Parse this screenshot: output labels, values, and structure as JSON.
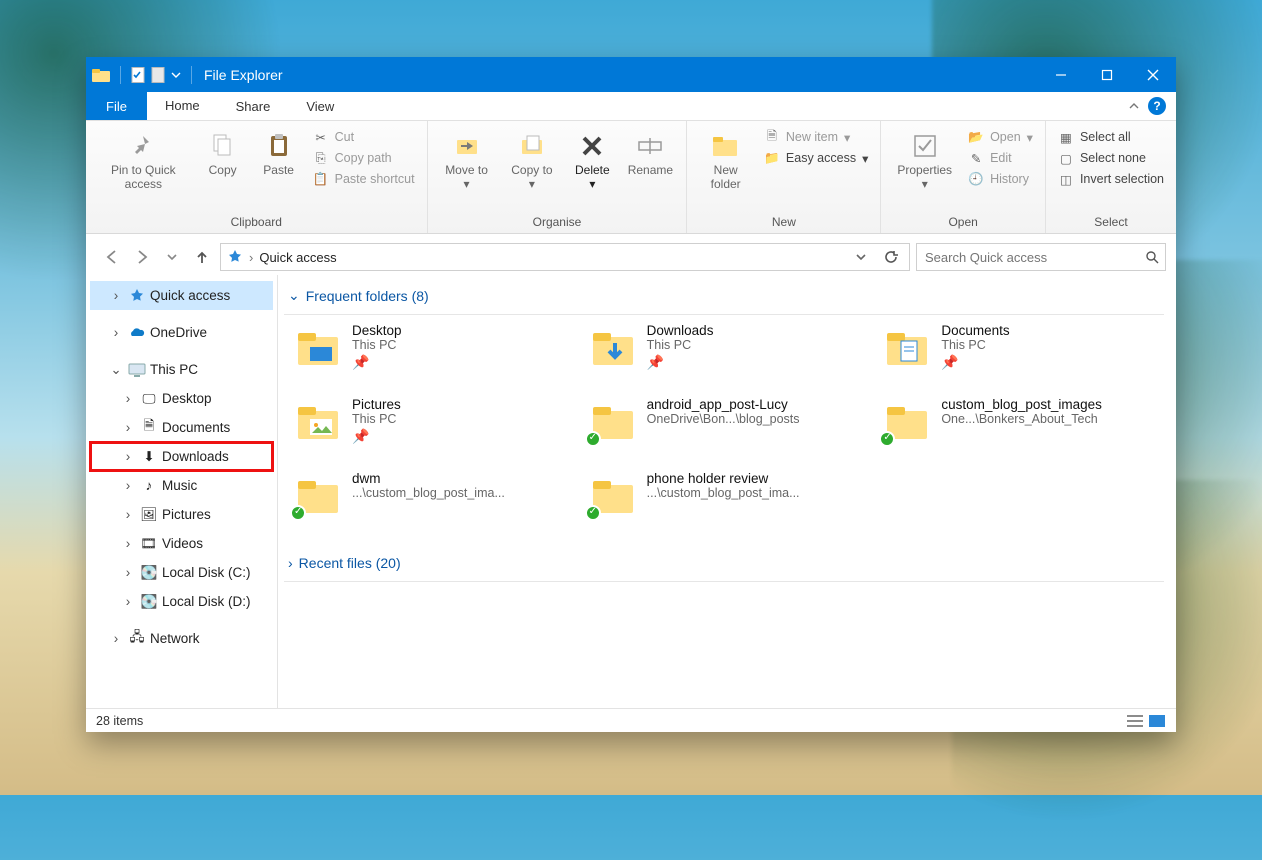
{
  "titlebar": {
    "title": "File Explorer"
  },
  "tabs": {
    "file": "File",
    "home": "Home",
    "share": "Share",
    "view": "View"
  },
  "ribbon": {
    "clipboard": {
      "label": "Clipboard",
      "pin": "Pin to Quick access",
      "copy": "Copy",
      "paste": "Paste",
      "cut": "Cut",
      "copyPath": "Copy path",
      "pasteShortcut": "Paste shortcut"
    },
    "organise": {
      "label": "Organise",
      "moveTo": "Move to",
      "copyTo": "Copy to",
      "delete": "Delete",
      "rename": "Rename"
    },
    "new": {
      "label": "New",
      "newFolder": "New folder",
      "newItem": "New item",
      "easyAccess": "Easy access"
    },
    "open": {
      "label": "Open",
      "properties": "Properties",
      "open": "Open",
      "edit": "Edit",
      "history": "History"
    },
    "select": {
      "label": "Select",
      "selectAll": "Select all",
      "selectNone": "Select none",
      "invert": "Invert selection"
    }
  },
  "address": {
    "crumb0": "Quick access"
  },
  "search": {
    "placeholder": "Search Quick access"
  },
  "tree": {
    "quickAccess": "Quick access",
    "oneDrive": "OneDrive",
    "thisPC": "This PC",
    "desktop": "Desktop",
    "documents": "Documents",
    "downloads": "Downloads",
    "music": "Music",
    "pictures": "Pictures",
    "videos": "Videos",
    "localC": "Local Disk (C:)",
    "localD": "Local Disk (D:)",
    "network": "Network"
  },
  "sections": {
    "frequent": "Frequent folders (8)",
    "recent": "Recent files (20)"
  },
  "folders": [
    {
      "name": "Desktop",
      "sub": "This PC",
      "pinned": true,
      "type": "desktop"
    },
    {
      "name": "Downloads",
      "sub": "This PC",
      "pinned": true,
      "type": "downloads"
    },
    {
      "name": "Documents",
      "sub": "This PC",
      "pinned": true,
      "type": "documents"
    },
    {
      "name": "Pictures",
      "sub": "This PC",
      "pinned": true,
      "type": "pictures"
    },
    {
      "name": "android_app_post-Lucy",
      "sub": "OneDrive\\Bon...\\blog_posts",
      "pinned": false,
      "type": "sync"
    },
    {
      "name": "custom_blog_post_images",
      "sub": "One...\\Bonkers_About_Tech",
      "pinned": false,
      "type": "sync"
    },
    {
      "name": "dwm",
      "sub": "...\\custom_blog_post_ima...",
      "pinned": false,
      "type": "sync"
    },
    {
      "name": "phone holder review",
      "sub": "...\\custom_blog_post_ima...",
      "pinned": false,
      "type": "sync"
    }
  ],
  "status": {
    "items": "28 items"
  }
}
